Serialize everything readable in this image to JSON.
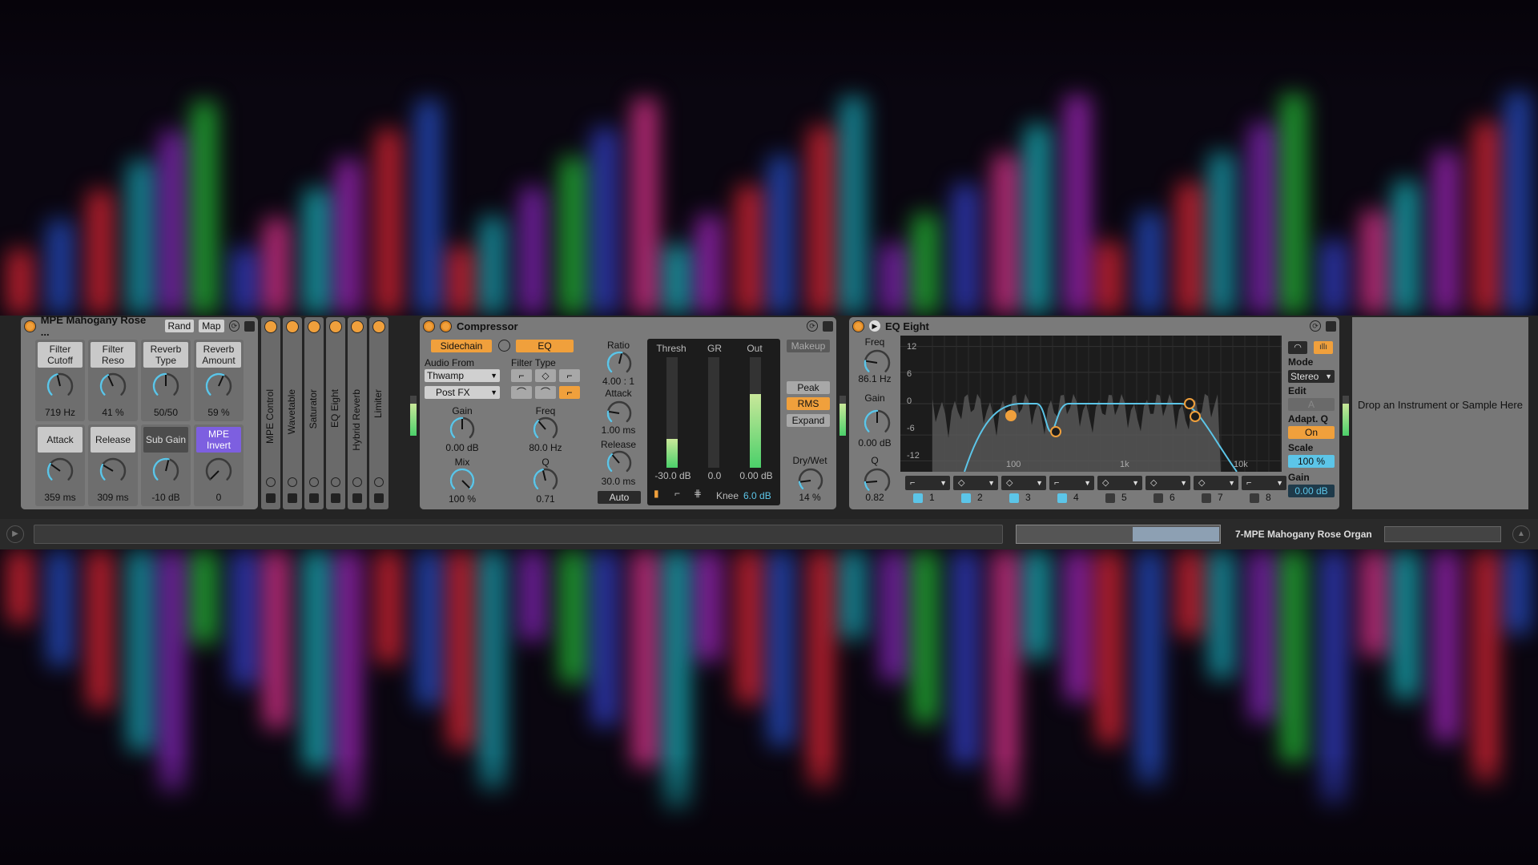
{
  "colors": {
    "accent": "#f0a03c",
    "panel": "#7a7a7a",
    "purple": "#7d5fe0",
    "blue": "#5cc5e8",
    "meter_green": "#4bd06a"
  },
  "rack": {
    "title": "MPE Mahogany Rose ...",
    "rand": "Rand",
    "map": "Map",
    "macros": [
      {
        "label": "Filter Cutoff",
        "value": "719 Hz"
      },
      {
        "label": "Filter Reso",
        "value": "41 %"
      },
      {
        "label": "Reverb Type",
        "value": "50/50"
      },
      {
        "label": "Reverb Amount",
        "value": "59 %"
      },
      {
        "label": "Attack",
        "value": "359 ms"
      },
      {
        "label": "Release",
        "value": "309 ms"
      },
      {
        "label": "Sub Gain",
        "value": "-10 dB"
      },
      {
        "label": "MPE Invert",
        "value": "0"
      }
    ],
    "chain": [
      "MPE Control",
      "Wavetable",
      "Saturator",
      "EQ Eight",
      "Hybrid Reverb",
      "Limiter"
    ]
  },
  "compressor": {
    "title": "Compressor",
    "sidechain": "Sidechain",
    "eq": "EQ",
    "audio_from": "Audio From",
    "source": "Thwamp",
    "post": "Post FX",
    "filter_type": "Filter Type",
    "gain_label": "Gain",
    "gain": "0.00 dB",
    "mix_label": "Mix",
    "mix": "100 %",
    "freq_label": "Freq",
    "freq": "80.0 Hz",
    "q_label": "Q",
    "q": "0.71",
    "ratio_label": "Ratio",
    "ratio": "4.00 : 1",
    "attack_label": "Attack",
    "attack": "1.00 ms",
    "release_label": "Release",
    "release": "30.0 ms",
    "auto": "Auto",
    "thresh_label": "Thresh",
    "gr_label": "GR",
    "out_label": "Out",
    "thresh": "-30.0 dB",
    "gr": "0.0",
    "out": "0.00 dB",
    "knee_label": "Knee",
    "knee": "6.0 dB",
    "makeup": "Makeup",
    "peak": "Peak",
    "rms": "RMS",
    "expand": "Expand",
    "drywet_label": "Dry/Wet",
    "drywet": "14 %"
  },
  "eq": {
    "title": "EQ Eight",
    "freq_label": "Freq",
    "freq": "86.1 Hz",
    "gain_label": "Gain",
    "gain": "0.00 dB",
    "q_label": "Q",
    "q": "0.82",
    "db_ticks": [
      "12",
      "6",
      "0",
      "-6",
      "-12"
    ],
    "freq_ticks": [
      "100",
      "1k",
      "10k"
    ],
    "bands": [
      "1",
      "2",
      "3",
      "4",
      "5",
      "6",
      "7",
      "8"
    ],
    "mode_label": "Mode",
    "mode": "Stereo",
    "edit_label": "Edit",
    "edit": "A",
    "adaptq_label": "Adapt. Q",
    "adaptq": "On",
    "scale_label": "Scale",
    "scale": "100 %",
    "gain2_label": "Gain",
    "gain2": "0.00 dB"
  },
  "drop_text": "Drop an Instrument or Sample Here",
  "track_name": "7-MPE Mahogany Rose Organ"
}
